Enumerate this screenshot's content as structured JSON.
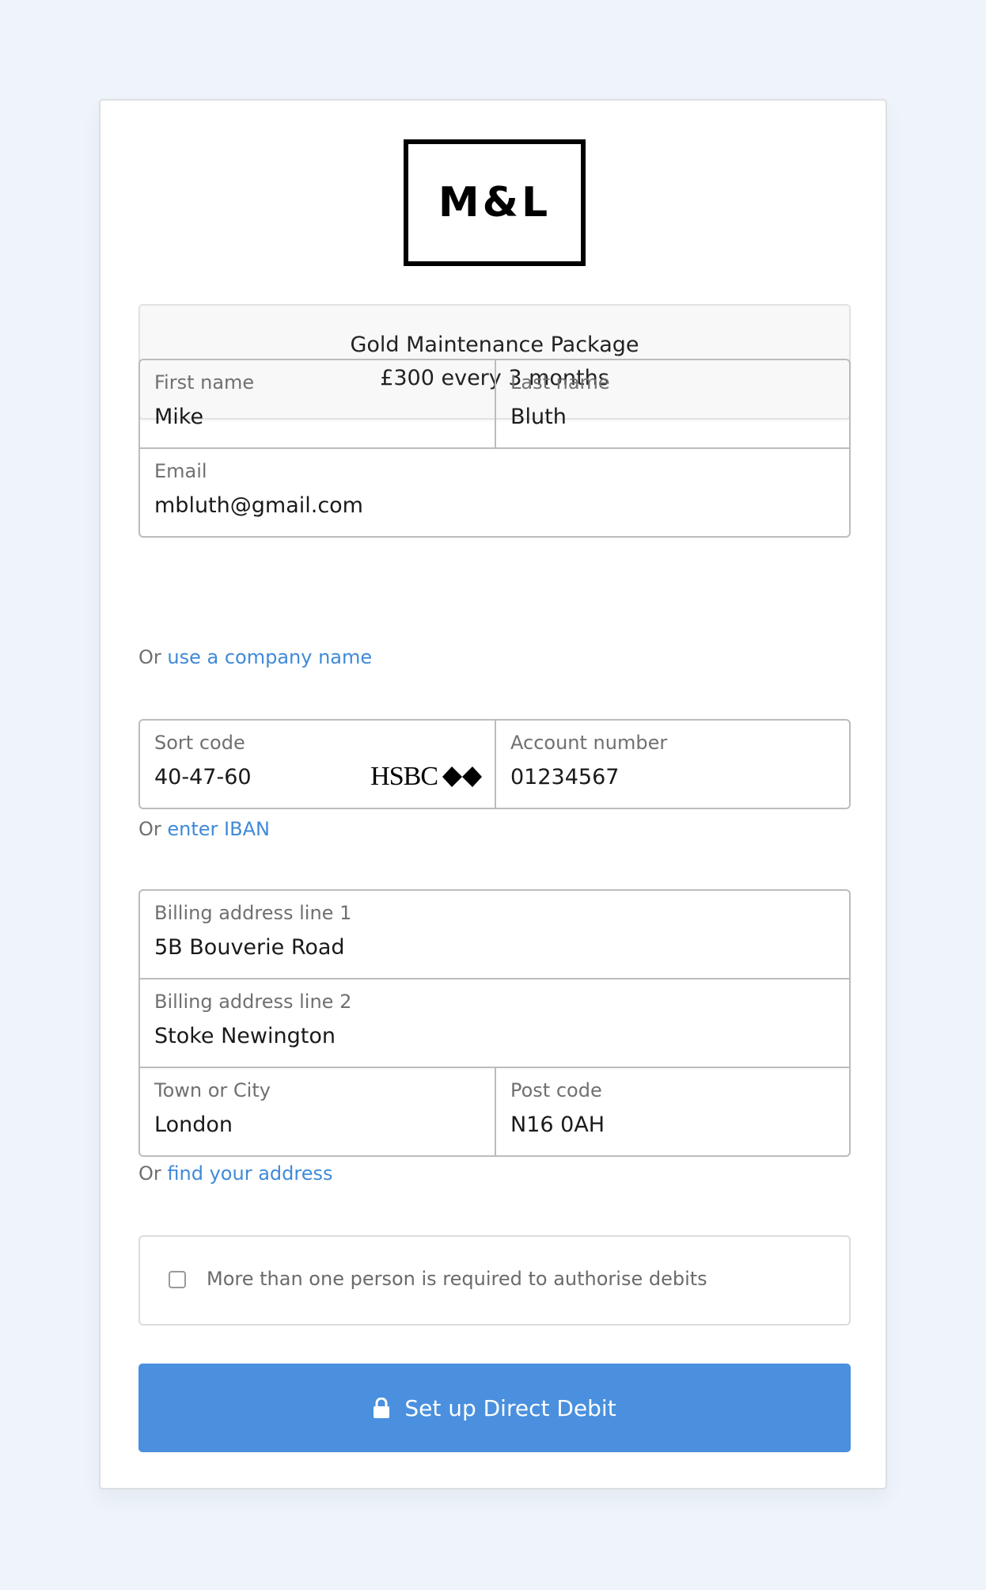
{
  "logo": {
    "text": "M&L"
  },
  "package": {
    "name": "Gold Maintenance Package",
    "price": "£300 every 3 months"
  },
  "personal": {
    "first_name": {
      "label": "First name",
      "value": "Mike"
    },
    "last_name": {
      "label": "Last name",
      "value": "Bluth"
    },
    "email": {
      "label": "Email",
      "value": "mbluth@gmail.com"
    },
    "alt_prefix": "Or",
    "alt_link": "use a company name"
  },
  "bank": {
    "sort_code": {
      "label": "Sort code",
      "value": "40-47-60"
    },
    "bank_name": "HSBC",
    "bank_icon": "hsbc-hexagon-logo",
    "account_number": {
      "label": "Account number",
      "value": "01234567"
    },
    "alt_prefix": "Or",
    "alt_link": "enter IBAN"
  },
  "address": {
    "line1": {
      "label": "Billing address line 1",
      "value": "5B Bouverie Road"
    },
    "line2": {
      "label": "Billing address line 2",
      "value": "Stoke Newington"
    },
    "town": {
      "label": "Town or City",
      "value": "London"
    },
    "postcode": {
      "label": "Post code",
      "value": "N16 0AH"
    },
    "alt_prefix": "Or",
    "alt_link": "find your address"
  },
  "authorisation": {
    "checked": false,
    "label": "More than one person is required to authorise debits"
  },
  "submit": {
    "label": "Set up Direct Debit",
    "icon": "lock-icon",
    "color": "#4a90de"
  },
  "colors": {
    "background": "#eff4fb",
    "link": "#3f8ad8",
    "border": "#bcbcbc"
  }
}
